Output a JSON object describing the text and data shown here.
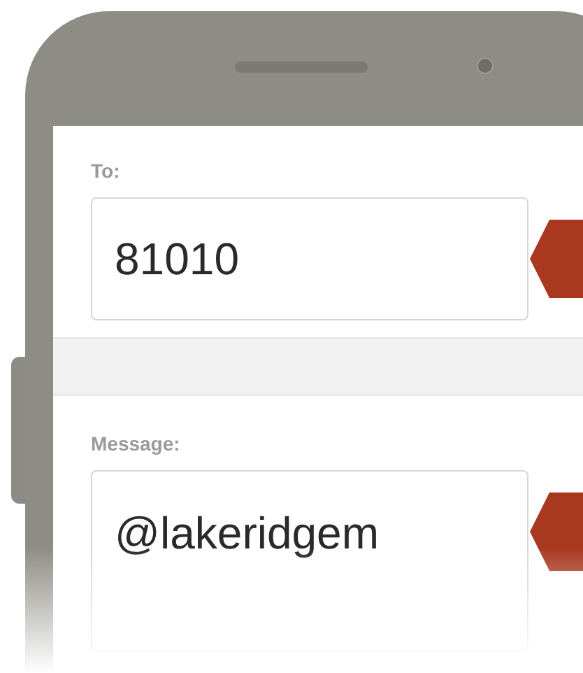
{
  "fields": [
    {
      "label": "To:",
      "value": "81010"
    },
    {
      "label": "Message:",
      "value": "@lakeridgem"
    }
  ]
}
